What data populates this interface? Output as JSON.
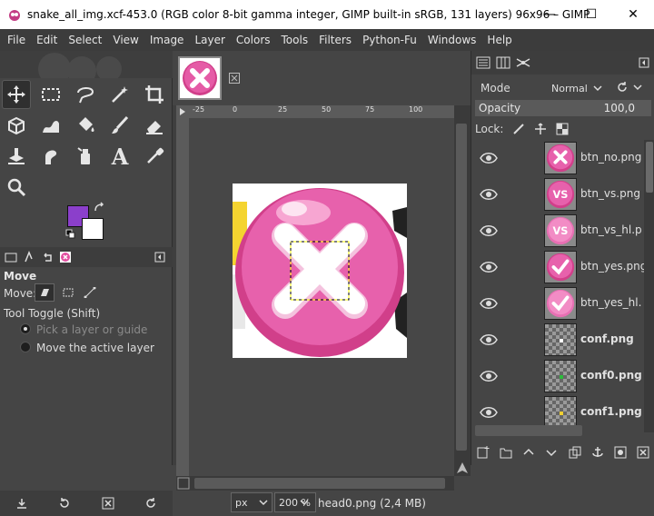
{
  "window": {
    "title": "snake_all_img.xcf-453.0 (RGB color 8-bit gamma integer, GIMP built-in sRGB, 131 layers) 96x96 – GIMP",
    "minimize": "—",
    "maximize": "☐",
    "close": "✕"
  },
  "menu": [
    "File",
    "Edit",
    "Select",
    "View",
    "Image",
    "Layer",
    "Colors",
    "Tools",
    "Filters",
    "Python-Fu",
    "Windows",
    "Help"
  ],
  "colors": {
    "foreground": "#8b3fcb",
    "background": "#ffffff",
    "accent_pink": "#e24fa0"
  },
  "tool_options": {
    "title": "Move",
    "move_label": "Move:",
    "tool_toggle": "Tool Toggle  (Shift)",
    "option1": "Pick a layer or guide",
    "option2": "Move the active layer"
  },
  "canvas": {
    "ruler_ticks": [
      "-25",
      "0",
      "25",
      "50",
      "75",
      "100"
    ],
    "unit": "px",
    "zoom": "200 %",
    "status": "head0.png (2,4 MB)"
  },
  "layers_panel": {
    "mode_label": "Mode",
    "mode_value": "Normal",
    "opacity_label": "Opacity",
    "opacity_value": "100,0",
    "lock_label": "Lock:",
    "layers": [
      {
        "name": "btn_no.png",
        "thumb": "x"
      },
      {
        "name": "btn_vs.png",
        "thumb": "vs"
      },
      {
        "name": "btn_vs_hl.p",
        "thumb": "vs"
      },
      {
        "name": "btn_yes.png",
        "thumb": "check"
      },
      {
        "name": "btn_yes_hl.",
        "thumb": "check"
      },
      {
        "name": "conf.png",
        "thumb": "conf"
      },
      {
        "name": "conf0.png",
        "thumb": "conf0"
      },
      {
        "name": "conf1.png",
        "thumb": "conf1"
      }
    ]
  }
}
